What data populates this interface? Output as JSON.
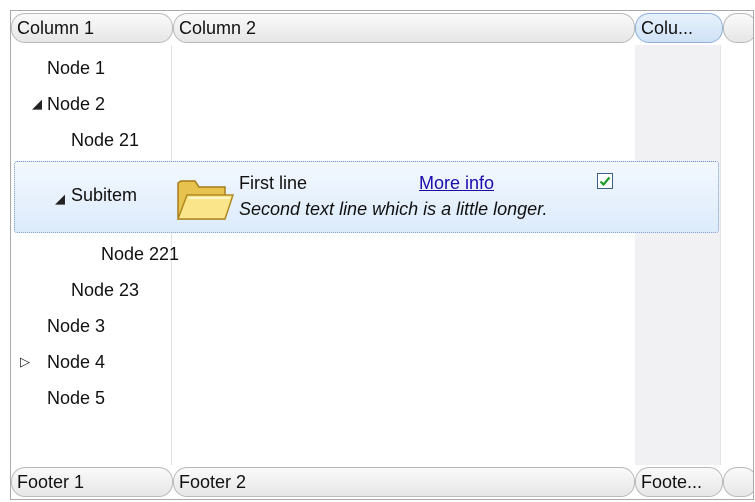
{
  "header": {
    "col1": "Column 1",
    "col2": "Column 2",
    "col3": "Colu..."
  },
  "nodes": {
    "n1": "Node 1",
    "n2": "Node 2",
    "n21": "Node 21",
    "subitem": "Subitem",
    "n221": "Node 221",
    "n23": "Node 23",
    "n3": "Node 3",
    "n4": "Node 4",
    "n5": "Node 5"
  },
  "subitem_content": {
    "first_line": "First line",
    "link": "More info",
    "second_line": "Second text line which is a little longer.",
    "checked": true,
    "icon": "folder-icon"
  },
  "footer": {
    "col1": "Footer 1",
    "col2": "Footer 2",
    "col3": "Foote..."
  },
  "glyphs": {
    "expanded": "◢",
    "collapsed": "▷",
    "check": "✓"
  }
}
